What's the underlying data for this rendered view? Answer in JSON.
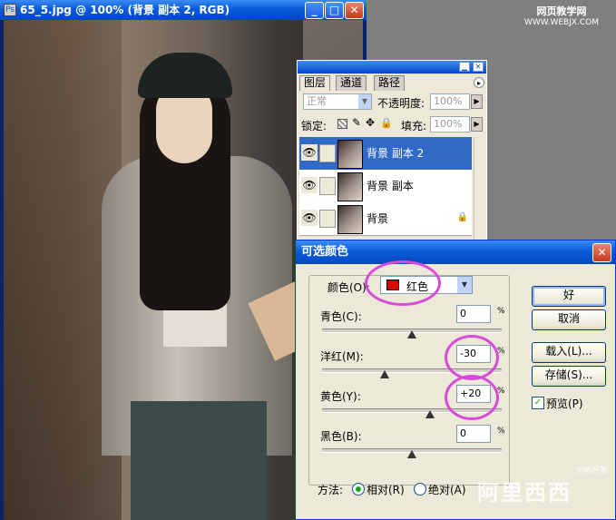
{
  "document": {
    "title": "65_5.jpg @ 100% (背景 副本 2, RGB)",
    "window_buttons": [
      "_",
      "□",
      "✕"
    ]
  },
  "watermark": {
    "line1": "网页教学网",
    "line2": "WWW.WEBJX.COM"
  },
  "layers_panel": {
    "tabs": [
      "图层",
      "通道",
      "路径"
    ],
    "blend_mode": "正常",
    "opacity_label": "不透明度:",
    "opacity_value": "100%",
    "lock_label": "锁定:",
    "fill_label": "填充:",
    "fill_value": "100%",
    "layers": [
      {
        "name": "背景 副本 2",
        "selected": true
      },
      {
        "name": "背景 副本",
        "selected": false
      },
      {
        "name": "背景",
        "selected": false,
        "locked": true
      }
    ]
  },
  "selective_color": {
    "title": "可选颜色",
    "color_label": "颜色(O):",
    "color_value": "红色",
    "swatch_color": "#e00000",
    "sliders": [
      {
        "label": "青色(C):",
        "value": "0",
        "fraction": 0.5
      },
      {
        "label": "洋红(M):",
        "value": "-30",
        "fraction": 0.35
      },
      {
        "label": "黄色(Y):",
        "value": "+20",
        "fraction": 0.6
      },
      {
        "label": "黑色(B):",
        "value": "0",
        "fraction": 0.5
      }
    ],
    "percent": "%",
    "buttons": {
      "ok": "好",
      "cancel": "取消",
      "load": "载入(L)...",
      "save": "存储(S)..."
    },
    "preview_label": "预览(P)",
    "preview_checked": true,
    "method_label": "方法:",
    "method_relative": "相对(R)",
    "method_absolute": "绝对(A)",
    "method_selected": "relative"
  },
  "dialog_watermark": {
    "main": "阿里西西",
    "small": "996开发"
  }
}
